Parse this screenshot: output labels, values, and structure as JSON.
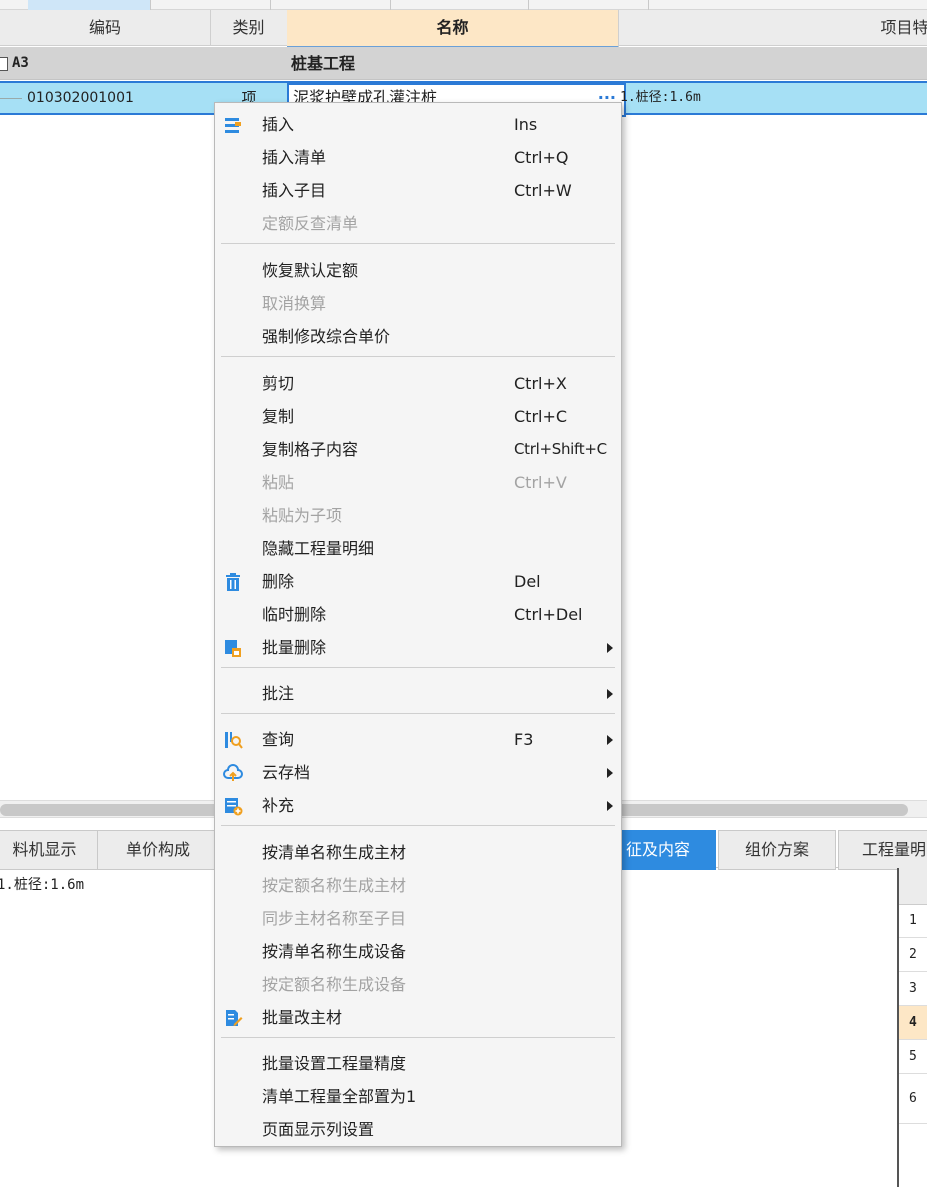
{
  "table": {
    "headers": {
      "code": "编码",
      "type": "类别",
      "name": "名称",
      "feature": "项目特征"
    },
    "group_row": {
      "code": "A3",
      "name": "桩基工程"
    },
    "selected_row": {
      "code": "010302001001",
      "type": "项",
      "name": "泥浆护壁成孔灌注桩",
      "ellipsis": "···",
      "feature": "1.桩径:1.6m"
    }
  },
  "bottom": {
    "tabs": [
      "料机显示",
      "单价构成",
      "征及内容",
      "组价方案",
      "工程量明"
    ],
    "active_tab": "征及内容",
    "content_text": "1.桩径:1.6m",
    "row_numbers": [
      "1",
      "2",
      "3",
      "4",
      "5",
      "6"
    ],
    "selected_row_number": "4"
  },
  "context_menu": {
    "items": [
      {
        "label": "插入",
        "shortcut": "Ins",
        "icon": "insert-lines-icon",
        "disabled": false
      },
      {
        "label": "插入清单",
        "shortcut": "Ctrl+Q",
        "disabled": false
      },
      {
        "label": "插入子目",
        "shortcut": "Ctrl+W",
        "disabled": false
      },
      {
        "label": "定额反查清单",
        "shortcut": "",
        "disabled": true
      },
      {
        "label": "恢复默认定额",
        "shortcut": "",
        "disabled": false
      },
      {
        "label": "取消换算",
        "shortcut": "",
        "disabled": true
      },
      {
        "label": "强制修改综合单价",
        "shortcut": "",
        "disabled": false
      },
      {
        "label": "剪切",
        "shortcut": "Ctrl+X",
        "disabled": false
      },
      {
        "label": "复制",
        "shortcut": "Ctrl+C",
        "disabled": false
      },
      {
        "label": "复制格子内容",
        "shortcut": "Ctrl+Shift+C",
        "disabled": false
      },
      {
        "label": "粘贴",
        "shortcut": "Ctrl+V",
        "disabled": true
      },
      {
        "label": "粘贴为子项",
        "shortcut": "",
        "disabled": true
      },
      {
        "label": "隐藏工程量明细",
        "shortcut": "",
        "disabled": false
      },
      {
        "label": "删除",
        "shortcut": "Del",
        "icon": "trash-icon",
        "disabled": false
      },
      {
        "label": "临时删除",
        "shortcut": "Ctrl+Del",
        "disabled": false
      },
      {
        "label": "批量删除",
        "shortcut": "",
        "icon": "batch-delete-icon",
        "submenu": true,
        "disabled": false
      },
      {
        "label": "批注",
        "shortcut": "",
        "submenu": true,
        "disabled": false
      },
      {
        "label": "查询",
        "shortcut": "F3",
        "icon": "query-icon",
        "submenu": true,
        "disabled": false
      },
      {
        "label": "云存档",
        "shortcut": "",
        "icon": "cloud-upload-icon",
        "submenu": true,
        "disabled": false
      },
      {
        "label": "补充",
        "shortcut": "",
        "icon": "supplement-icon",
        "submenu": true,
        "disabled": false
      },
      {
        "label": "按清单名称生成主材",
        "shortcut": "",
        "disabled": false
      },
      {
        "label": "按定额名称生成主材",
        "shortcut": "",
        "disabled": true
      },
      {
        "label": "同步主材名称至子目",
        "shortcut": "",
        "disabled": true
      },
      {
        "label": "按清单名称生成设备",
        "shortcut": "",
        "disabled": false
      },
      {
        "label": "按定额名称生成设备",
        "shortcut": "",
        "disabled": true
      },
      {
        "label": "批量改主材",
        "shortcut": "",
        "icon": "batch-edit-icon",
        "disabled": false
      },
      {
        "label": "批量设置工程量精度",
        "shortcut": "",
        "disabled": false
      },
      {
        "label": "清单工程量全部置为1",
        "shortcut": "",
        "disabled": false
      },
      {
        "label": "页面显示列设置",
        "shortcut": "",
        "disabled": false
      }
    ]
  },
  "colors": {
    "accent": "#2e8be0",
    "selected_row": "#a6e0f5",
    "active_header": "#fde7c6",
    "disabled_text": "#a3a3a3"
  }
}
